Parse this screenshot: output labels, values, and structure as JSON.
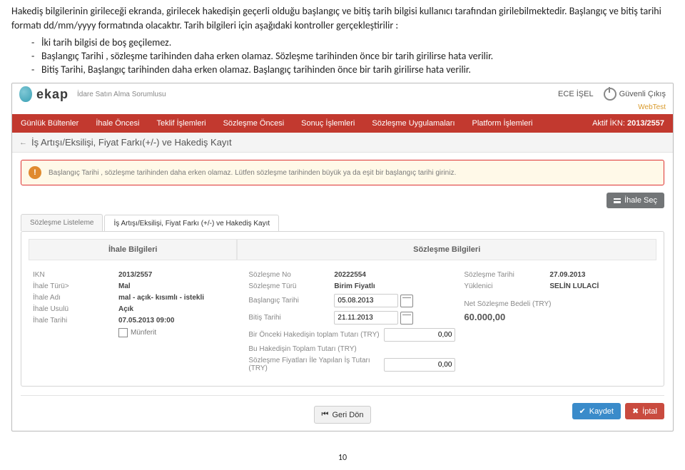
{
  "doc": {
    "intro": "Hakediş bilgilerinin girileceği ekranda, girilecek hakedişin geçerli olduğu başlangıç ve bitiş tarih bilgisi kullanıcı tarafından girilebilmektedir. Başlangıç ve bitiş tarihi formatı dd/mm/yyyy formatında olacaktır. Tarih bilgileri için aşağıdaki kontroller gerçekleştirilir :",
    "bullets": [
      "İki tarih bilgisi de boş geçilemez.",
      "Başlangıç Tarihi , sözleşme tarihinden daha erken olamaz. Sözleşme tarihinden önce bir tarih girilirse hata verilir.",
      "Bitiş Tarihi, Başlangıç tarihinden daha erken olamaz. Başlangıç tarihinden önce bir tarih girilirse hata verilir."
    ],
    "page_number": "10"
  },
  "app": {
    "logo_text": "ekap",
    "logo_sub": "İdare Satın Alma Sorumlusu",
    "user_name": "ECE İŞEL",
    "logout": "Güvenli Çıkış",
    "env": "WebTest",
    "nav": [
      "Günlük Bültenler",
      "İhale Öncesi",
      "Teklif İşlemleri",
      "Sözleşme Öncesi",
      "Sonuç İşlemleri",
      "Sözleşme Uygulamaları",
      "Platform İşlemleri"
    ],
    "ikn_label": "Aktif İKN:",
    "ikn_value": "2013/2557",
    "crumb_title": "İş Artışı/Eksilişi, Fiyat Farkı(+/-) ve Hakediş Kayıt",
    "alert": "Başlangıç Tarihi , sözleşme tarihinden daha erken olamaz. Lütfen sözleşme tarihinden büyük ya da eşit bir başlangıç tarihi giriniz.",
    "btn_select": "İhale Seç",
    "tabs": [
      "Sözleşme Listeleme",
      "İş Artışı/Eksilişi, Fiyat Farkı (+/-) ve Hakediş Kayıt"
    ],
    "section_left": "İhale Bilgileri",
    "section_right": "Sözleşme Bilgileri",
    "ihale": {
      "ikn_lbl": "IKN",
      "ikn": "2013/2557",
      "tur_lbl": "İhale Türü>",
      "tur": "Mal",
      "ad_lbl": "İhale Adı",
      "ad": "mal - açık- kısımlı - istekli",
      "usul_lbl": "İhale Usulü",
      "usul": "Açık",
      "tarih_lbl": "İhale Tarihi",
      "tarih": "07.05.2013 09:00",
      "munferit": "Münferit"
    },
    "soz": {
      "no_lbl": "Sözleşme No",
      "no": "20222554",
      "tur_lbl": "Sözleşme Türü",
      "tur": "Birim Fiyatlı",
      "bas_lbl": "Başlangıç Tarihi",
      "bas": "05.08.2013",
      "bit_lbl": "Bitiş Tarihi",
      "bit": "21.11.2013",
      "onceki_lbl": "Bir Önceki Hakedişin toplam Tutarı (TRY)",
      "onceki": "0,00",
      "bu_lbl": "Bu Hakedişin Toplam Tutarı (TRY)",
      "fiy_lbl": "Sözleşme Fiyatları İle Yapılan İş Tutarı (TRY)",
      "fiy": "0,00",
      "tarih_lbl": "Sözleşme Tarihi",
      "tarih": "27.09.2013",
      "yuk_lbl": "Yüklenici",
      "yuk": "SELİN LULACİ",
      "bedel_lbl": "Net Sözleşme Bedeli (TRY)",
      "bedel": "60.000,00"
    },
    "btn_back": "Geri Dön",
    "btn_save": "Kaydet",
    "btn_cancel": "İptal"
  }
}
